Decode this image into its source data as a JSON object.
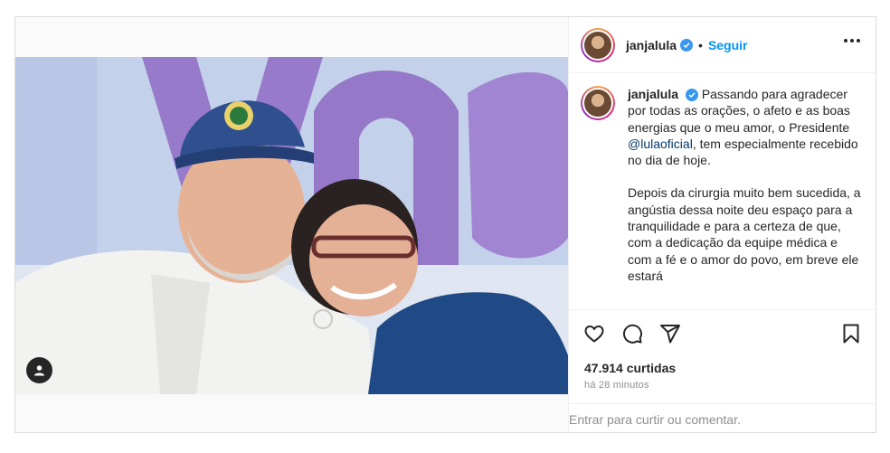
{
  "author": {
    "username": "janjalula",
    "follow_label": "Seguir",
    "separator": "•"
  },
  "caption": {
    "username": "janjalula",
    "paragraph_1_start": "Passando para agradecer por todas as orações, o afeto e as boas energias que o meu amor, o Presidente ",
    "mention": "@lulaoficial",
    "paragraph_1_end": ", tem especialmente recebido no dia de hoje.",
    "paragraph_2": "Depois da cirurgia muito bem sucedida, a angústia dessa noite deu espaço para a tranquilidade e para a certeza de que, com a dedicação da equipe médica e com a fé e o amor do povo, em breve ele estará"
  },
  "stats": {
    "likes": "47.914 curtidas",
    "time_ago": "há 28 minutos"
  },
  "comment_bar": {
    "login_link": "Entrar",
    "rest": " para curtir ou comentar."
  },
  "icons": {
    "like": "heart-icon",
    "comment": "comment-icon",
    "share": "send-icon",
    "save": "bookmark-icon",
    "more": "more-icon",
    "user_tag": "user-tag-icon",
    "verified": "verified-badge-icon"
  },
  "colors": {
    "link_blue": "#0095f6",
    "verified_blue": "#3897f0",
    "mention_blue": "#00376b",
    "muted_text": "#8e8e8e"
  }
}
